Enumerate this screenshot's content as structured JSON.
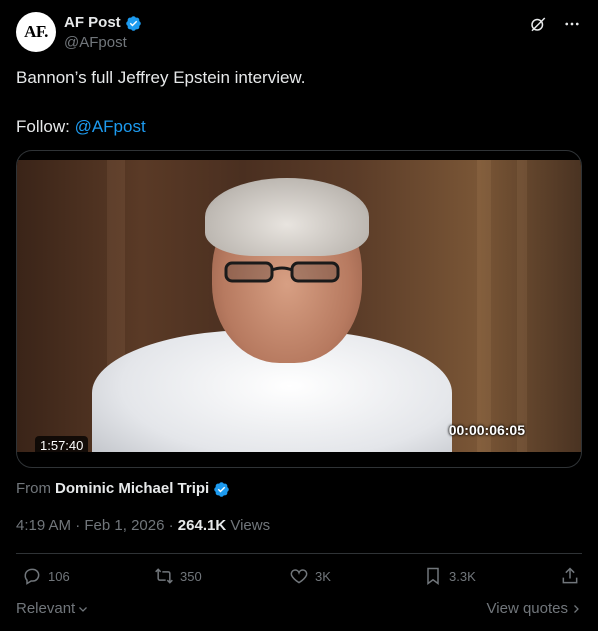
{
  "author": {
    "avatar_text": "AF.",
    "display_name": "AF Post",
    "handle": "@AFpost"
  },
  "tweet": {
    "text_line1": "Bannon’s full Jeffrey Epstein interview.",
    "follow_label": "Follow: ",
    "follow_mention": "@AFpost"
  },
  "video": {
    "timecode_overlay": "00:00:06:05",
    "duration": "1:57:40"
  },
  "source": {
    "from_label": "From",
    "from_name": "Dominic Michael Tripi"
  },
  "meta": {
    "time": "4:19 AM",
    "separator": " · ",
    "date": "Feb 1, 2026",
    "views_count": "264.1K",
    "views_label": "Views"
  },
  "actions": {
    "replies": "106",
    "reposts": "350",
    "likes": "3K",
    "bookmarks": "3.3K"
  },
  "footer": {
    "sort_label": "Relevant",
    "quotes_label": "View quotes"
  },
  "colors": {
    "accent": "#1d9bf0",
    "text": "#e7e9ea",
    "muted": "#71767b",
    "border": "#2f3336"
  }
}
